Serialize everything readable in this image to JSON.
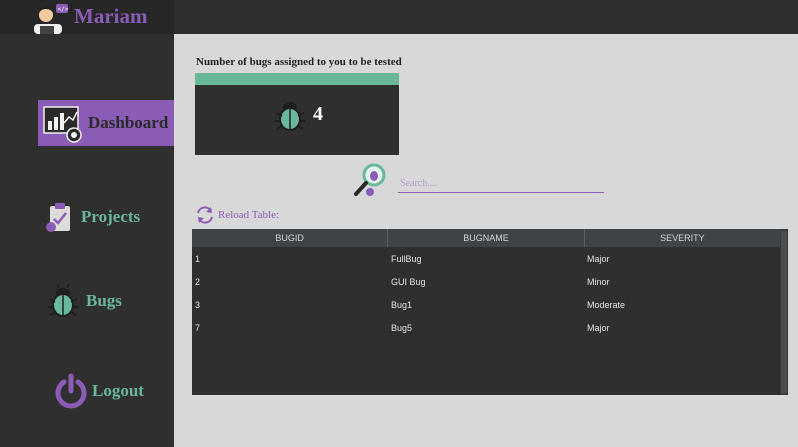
{
  "header": {
    "username": "Mariam"
  },
  "sidebar": {
    "items": [
      {
        "label": "Dashboard",
        "icon": "dashboard-icon",
        "active": true
      },
      {
        "label": "Projects",
        "icon": "clipboard-icon",
        "active": false
      },
      {
        "label": "Bugs",
        "icon": "bug-icon",
        "active": false
      },
      {
        "label": "Logout",
        "icon": "power-icon",
        "active": false
      }
    ]
  },
  "dashboard": {
    "card_title": "Number of bugs assigned to you to be tested",
    "card_count": "4",
    "search_placeholder": "Search....",
    "reload_label": "Reload Table:"
  },
  "table": {
    "columns": [
      "BUGID",
      "BUGNAME",
      "SEVERITY"
    ],
    "rows": [
      [
        "1",
        "FullBug",
        "Major"
      ],
      [
        "2",
        "GUI Bug",
        "Minor"
      ],
      [
        "3",
        "Bug1",
        "Moderate"
      ],
      [
        "7",
        "Bug5",
        "Major"
      ]
    ]
  },
  "colors": {
    "accent": "#8a5cb5",
    "green": "#6ab89a",
    "dark": "#2f2f2f"
  }
}
